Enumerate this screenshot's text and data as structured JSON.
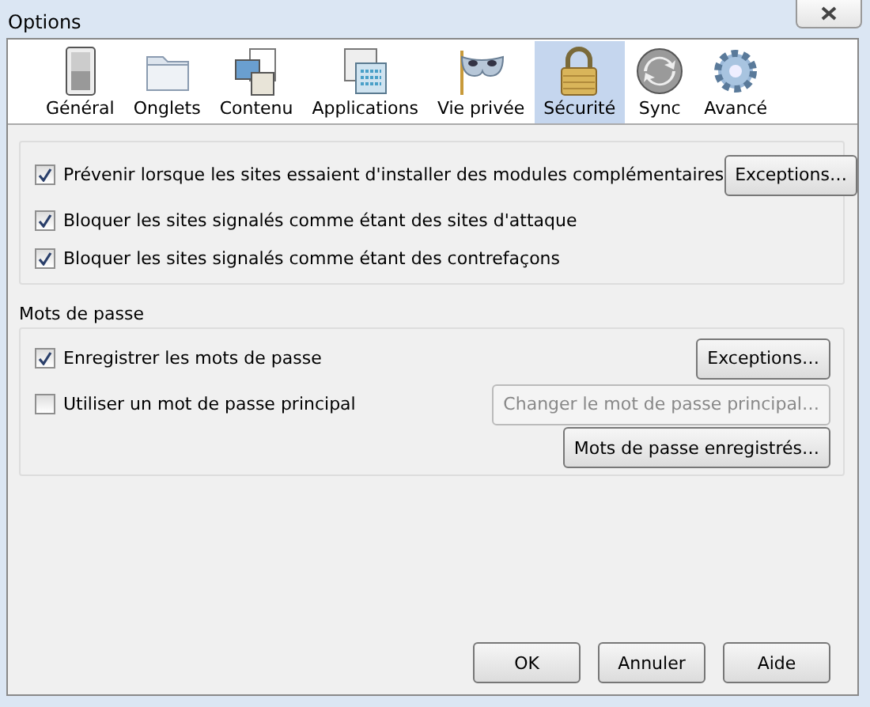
{
  "window": {
    "title": "Options"
  },
  "toolbar": [
    {
      "label": "Général",
      "selected": false
    },
    {
      "label": "Onglets",
      "selected": false
    },
    {
      "label": "Contenu",
      "selected": false
    },
    {
      "label": "Applications",
      "selected": false
    },
    {
      "label": "Vie privée",
      "selected": false
    },
    {
      "label": "Sécurité",
      "selected": true
    },
    {
      "label": "Sync",
      "selected": false
    },
    {
      "label": "Avancé",
      "selected": false
    }
  ],
  "general_group": {
    "rows": [
      {
        "label": "Prévenir lorsque les sites essaient d'installer des modules complémentaires",
        "checked": true,
        "button": {
          "label": "Exceptions…",
          "disabled": false
        }
      },
      {
        "label": "Bloquer les sites signalés comme étant des sites d'attaque",
        "checked": true
      },
      {
        "label": "Bloquer les sites signalés comme étant des contrefaçons",
        "checked": true
      }
    ]
  },
  "passwords_group": {
    "title": "Mots de passe",
    "rows": [
      {
        "label": "Enregistrer les mots de passe",
        "checked": true,
        "button": {
          "label": "Exceptions…",
          "disabled": false
        }
      },
      {
        "label": "Utiliser un mot de passe principal",
        "checked": false,
        "button": {
          "label": "Changer le mot de passe principal…",
          "disabled": true
        }
      }
    ],
    "extra_button": {
      "label": "Mots de passe enregistrés…",
      "disabled": false
    }
  },
  "buttons": [
    {
      "label": "OK"
    },
    {
      "label": "Annuler"
    },
    {
      "label": "Aide"
    }
  ]
}
